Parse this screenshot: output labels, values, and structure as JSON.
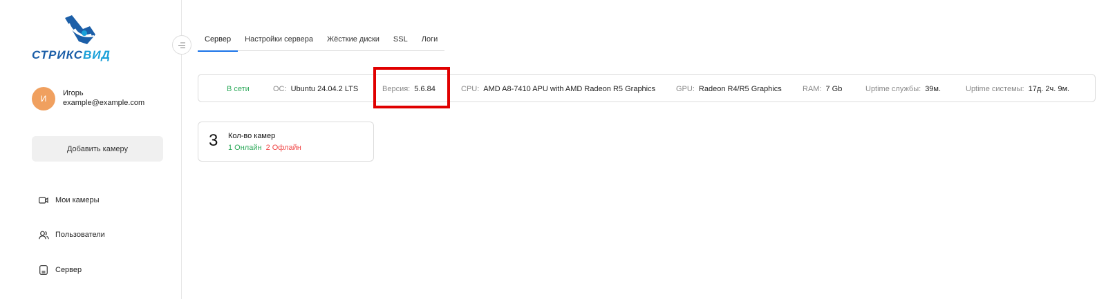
{
  "brand": {
    "part1": "СТРИКС",
    "part2": "ВИД"
  },
  "user": {
    "initial": "И",
    "name": "Игорь",
    "email": "example@example.com"
  },
  "sidebar": {
    "add_camera": "Добавить камеру",
    "items": [
      {
        "label": "Мои камеры",
        "icon": "camera-icon"
      },
      {
        "label": "Пользователи",
        "icon": "users-icon"
      },
      {
        "label": "Сервер",
        "icon": "server-icon"
      }
    ]
  },
  "tabs": [
    "Сервер",
    "Настройки сервера",
    "Жёсткие диски",
    "SSL",
    "Логи"
  ],
  "status": {
    "online": "В сети",
    "os_label": "ОС:",
    "os_value": "Ubuntu 24.04.2 LTS",
    "version_label": "Версия:",
    "version_value": "5.6.84",
    "cpu_label": "CPU:",
    "cpu_value": "AMD A8-7410 APU with AMD Radeon R5 Graphics",
    "gpu_label": "GPU:",
    "gpu_value": "Radeon R4/R5 Graphics",
    "ram_label": "RAM:",
    "ram_value": "7 Gb",
    "svc_uptime_label": "Uptime службы:",
    "svc_uptime_value": "39м.",
    "sys_uptime_label": "Uptime системы:",
    "sys_uptime_value": "17д. 2ч. 9м."
  },
  "cameras_card": {
    "count": "3",
    "title": "Кол-во камер",
    "online": "1 Онлайн",
    "offline": "2 Офлайн"
  },
  "colors": {
    "accent": "#1a73e8",
    "online": "#2eaa5b",
    "offline": "#f04646",
    "avatar": "#f0a05f",
    "highlight": "#e00000"
  }
}
